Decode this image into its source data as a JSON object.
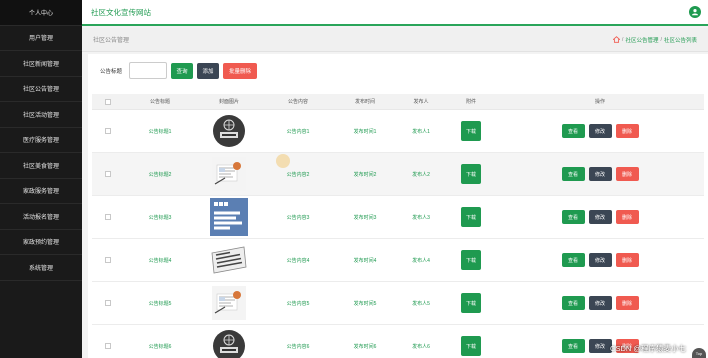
{
  "app": {
    "title": "社区文化宣传网站"
  },
  "sidebar": {
    "items": [
      {
        "label": "个人中心"
      },
      {
        "label": "用户管理"
      },
      {
        "label": "社区新闻管理"
      },
      {
        "label": "社区公告管理"
      },
      {
        "label": "社区活动管理"
      },
      {
        "label": "医疗服务管理"
      },
      {
        "label": "社区美食管理"
      },
      {
        "label": "家政服务管理"
      },
      {
        "label": "活动报名管理"
      },
      {
        "label": "家政预约管理"
      },
      {
        "label": "系统管理"
      }
    ]
  },
  "breadcrumb": {
    "page_title": "社区公告管理",
    "items": [
      "社区公告管理",
      "社区公告列表"
    ],
    "separator": "/"
  },
  "search": {
    "label": "公告标题",
    "value": "",
    "search_label": "查询",
    "add_label": "添加",
    "batch_delete_label": "批量删除"
  },
  "table": {
    "headers": {
      "title": "公告标题",
      "image": "封面图片",
      "content": "公告内容",
      "time": "发布时间",
      "publisher": "发布人",
      "attachment": "附件",
      "operations": "操作"
    },
    "rows": [
      {
        "title": "公告标题1",
        "image_icon": "world-news-globe-icon",
        "content": "公告内容1",
        "time": "发布时间1",
        "publisher": "发布人1"
      },
      {
        "title": "公告标题2",
        "image_icon": "newspaper-cup-icon",
        "content": "公告内容2",
        "time": "发布时间2",
        "publisher": "发布人2"
      },
      {
        "title": "公告标题3",
        "image_icon": "bbc-world-news-icon",
        "content": "公告内容3",
        "time": "发布时间3",
        "publisher": "发布人3"
      },
      {
        "title": "公告标题4",
        "image_icon": "news-paper-icon",
        "content": "公告内容4",
        "time": "发布时间4",
        "publisher": "发布人4"
      },
      {
        "title": "公告标题5",
        "image_icon": "newspaper-cup-icon",
        "content": "公告内容5",
        "time": "发布时间5",
        "publisher": "发布人5"
      },
      {
        "title": "公告标题6",
        "image_icon": "world-news-globe-icon",
        "content": "公告内容6",
        "time": "发布时间6",
        "publisher": "发布人6"
      }
    ],
    "download_label": "下载",
    "view_label": "查看",
    "edit_label": "修改",
    "delete_label": "删除"
  },
  "footer": {
    "watermark": "CSDN @程序猿麦小七",
    "top_label": "Top"
  },
  "colors": {
    "primary": "#1f9a50",
    "dark": "#3b4654",
    "danger": "#f05a50",
    "sidebar": "#1a1a1a"
  }
}
